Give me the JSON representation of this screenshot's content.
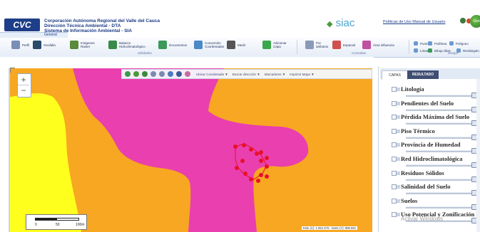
{
  "header": {
    "logo_text": "CVC",
    "org_line1": "Corporación Autónoma Regional del Valle del Cauca",
    "org_line2": "Dirección Técnica Ambiental - DTA",
    "org_line3": "Sistema de Información Ambiental - SIA",
    "siac_logo": "siac",
    "policy_link": "Políticas de Uso  Manual de Usuario",
    "menu_tab": "General",
    "globe_text": "Geo"
  },
  "toolbar": {
    "items": [
      {
        "label": "Perfil",
        "icon": "profile-icon",
        "color": "#7a8fb8"
      },
      {
        "label": "Geofalla",
        "icon": "geofalla-icon",
        "color": "#2a4a6a"
      },
      {
        "label": "Imágenes\nRaster",
        "icon": "raster-icon",
        "color": "#5a8a3a"
      },
      {
        "label": "Balance\nHidroclimatológico",
        "icon": "water-balance-icon",
        "color": "#3a8a4a"
      },
      {
        "label": "Documentos",
        "icon": "documents-icon",
        "color": "#3a9a5a"
      },
      {
        "label": "Conversión\nCoordenadas",
        "icon": "coordinates-icon",
        "color": "#4a8ac8"
      },
      {
        "label": "Medir",
        "icon": "ruler-icon",
        "color": "#555555"
      },
      {
        "label": "Adicionar\nCapa",
        "icon": "add-layer-icon",
        "color": "#3aa84a"
      },
      {
        "label": "Por\natributos",
        "icon": "attributes-icon",
        "color": "#8a9ab8"
      },
      {
        "label": "Espacial",
        "icon": "spatial-icon",
        "color": "#d05050"
      },
      {
        "label": "Área influencia",
        "icon": "influence-icon",
        "color": "#c050a0"
      },
      {
        "label": "Punto",
        "icon": "point-icon",
        "color": "#6a9ad0"
      },
      {
        "label": "Polilínea",
        "icon": "polyline-icon",
        "color": "#6a9ad0"
      },
      {
        "label": "Polígono",
        "icon": "polygon-icon",
        "color": "#6a9ad0"
      },
      {
        "label": "Línea",
        "icon": "line-icon",
        "color": "#6a9ad0"
      },
      {
        "label": "Dibujo libre",
        "icon": "freehand-icon",
        "color": "#3a9a5a"
      },
      {
        "label": "Rectángulo",
        "icon": "rectangle-icon",
        "color": "#6a9ad0"
      }
    ],
    "group_utilidades": "Utilidades",
    "group_consultas": "Consultas",
    "group_dibujar": "Dibujar"
  },
  "map": {
    "zoom_in": "+",
    "zoom_out": "−",
    "tool_menus": [
      "Ubicar Coordenada ▼",
      "Buscar dirección ▼",
      "Marcadores ▼",
      "Imprimir Mapa ▼"
    ],
    "scale_labels": [
      "0",
      "50",
      "100m"
    ],
    "coord_readout": "Este (X): 1.052.379 , Norte (Y): 885.981",
    "colors": {
      "orange": "#f7a722",
      "yellow": "#ffff1e",
      "magenta": "#ea3fae",
      "red": "#e8102a"
    }
  },
  "panel": {
    "tab_capas": "CAPAS",
    "tab_resultado": "RESULTADO",
    "layers": [
      "Litología",
      "Pendientes del Suelo",
      "Pérdida Máxima del Suelo",
      "Piso Térmico",
      "Provincia de Humedad",
      "Red Hidroclimatológica",
      "Residuos Sólidos",
      "Salinidad del Suelo",
      "Suelos",
      "Uso Potencial y Zonificación F"
    ],
    "activate_watermark": "Activar Windows"
  }
}
